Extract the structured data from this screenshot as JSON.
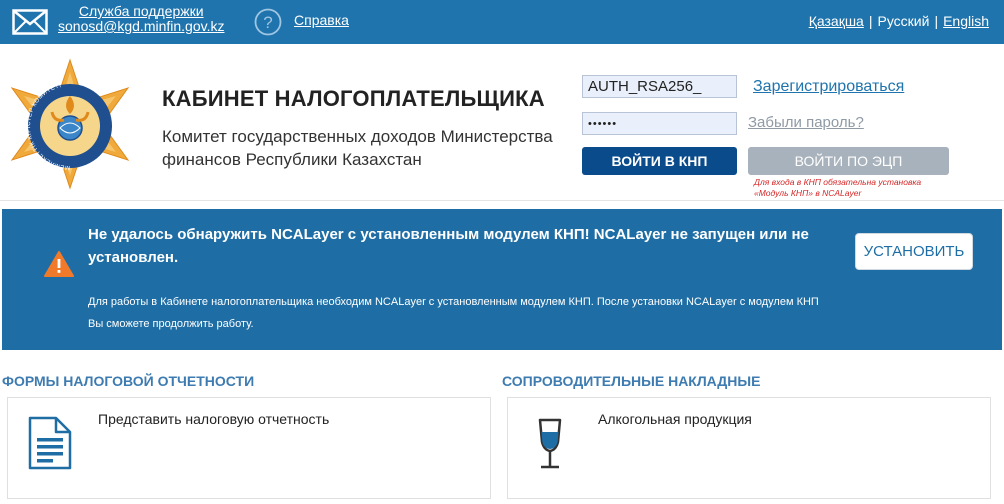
{
  "topbar": {
    "support_title": "Служба поддержки",
    "support_email": "sonosd@kgd.minfin.gov.kz",
    "help_label": "Справка",
    "languages": [
      "Қазақша",
      "Русский",
      "English"
    ],
    "language_separator": "|",
    "active_language": "Русский"
  },
  "header": {
    "title": "КАБИНЕТ НАЛОГОПЛАТЕЛЬЩИКА",
    "subtitle": "Комитет государственных доходов Министерства финансов Республики Казахстан",
    "logo_ring_text": "МЕМЛЕКЕТТІК КІРІСТЕР КОМИТЕТІ"
  },
  "login": {
    "login_value": "AUTH_RSA256_",
    "password_value": "••••••",
    "register_label": "Зарегистрироваться",
    "forgot_label": "Забыли пароль?",
    "login_button": "ВОЙТИ В КНП",
    "ecp_button": "ВОЙТИ ПО ЭЦП",
    "ecp_note": "Для входа в КНП обязательна установка «Модуль КНП» в NCALayer"
  },
  "banner": {
    "title": "Не удалось обнаружить NCALayer с установленным модулем КНП! NCALayer не запущен или не установлен.",
    "text": "Для работы в Кабинете налогоплательщика необходим NCALayer с установленным модулем КНП. После установки NCALayer с модулем КНП Вы сможете продолжить работу.",
    "install_button": "УСТАНОВИТЬ"
  },
  "sections": {
    "forms": {
      "title": "ФОРМЫ НАЛОГОВОЙ ОТЧЕТНОСТИ",
      "card_label": "Представить налоговую отчетность",
      "icon": "document-icon"
    },
    "waybills": {
      "title": "СОПРОВОДИТЕЛЬНЫЕ НАКЛАДНЫЕ",
      "card_label": "Алкогольная продукция",
      "icon": "wine-glass-icon"
    }
  },
  "colors": {
    "primary_blue": "#1f74ad",
    "dark_button": "#0a4b8c",
    "disabled_button": "#a8b2bc",
    "warning_orange": "#f07a2a",
    "note_red": "#d52828",
    "section_blue": "#3d7bb0"
  }
}
